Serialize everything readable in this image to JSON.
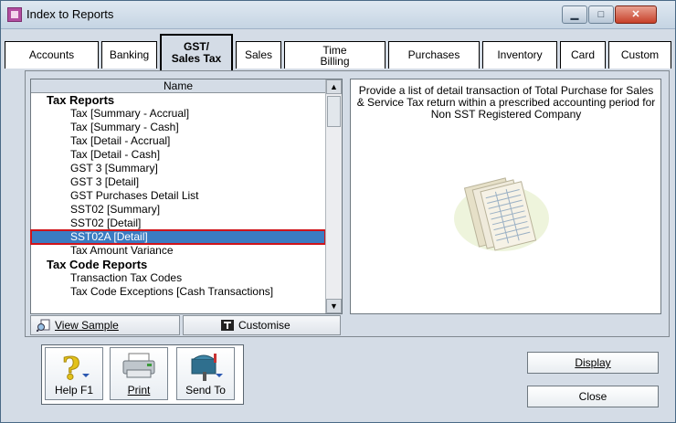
{
  "window": {
    "title": "Index to Reports"
  },
  "tabs": [
    {
      "label_a": "Accounts",
      "label_b": ""
    },
    {
      "label_a": "Banking",
      "label_b": ""
    },
    {
      "label_a": "GST/",
      "label_b": "Sales Tax"
    },
    {
      "label_a": "Sales",
      "label_b": ""
    },
    {
      "label_a": "Time",
      "label_b": "Billing"
    },
    {
      "label_a": "Purchases",
      "label_b": ""
    },
    {
      "label_a": "Inventory",
      "label_b": ""
    },
    {
      "label_a": "Card",
      "label_b": ""
    },
    {
      "label_a": "Custom",
      "label_b": ""
    }
  ],
  "list": {
    "header": "Name",
    "rows": [
      {
        "text": "Tax Reports",
        "type": "category"
      },
      {
        "text": "Tax [Summary - Accrual]",
        "type": "item"
      },
      {
        "text": "Tax [Summary - Cash]",
        "type": "item"
      },
      {
        "text": "Tax [Detail - Accrual]",
        "type": "item"
      },
      {
        "text": "Tax [Detail - Cash]",
        "type": "item"
      },
      {
        "text": "GST 3 [Summary]",
        "type": "item"
      },
      {
        "text": "GST 3 [Detail]",
        "type": "item"
      },
      {
        "text": "GST Purchases Detail List",
        "type": "item"
      },
      {
        "text": "SST02 [Summary]",
        "type": "item"
      },
      {
        "text": "SST02 [Detail]",
        "type": "item"
      },
      {
        "text": "SST02A [Detail]",
        "type": "item",
        "selected": true
      },
      {
        "text": "Tax Amount Variance",
        "type": "item"
      },
      {
        "text": "Tax Code Reports",
        "type": "category"
      },
      {
        "text": "Transaction Tax Codes",
        "type": "item"
      },
      {
        "text": "Tax Code Exceptions [Cash Transactions]",
        "type": "item"
      }
    ]
  },
  "description": "Provide a list of detail transaction of Total Purchase for Sales & Service Tax return within a prescribed accounting period for Non SST Registered Company",
  "panel_buttons": {
    "view_sample": "View Sample",
    "customise": "Customise"
  },
  "bottom_buttons": {
    "help": "Help F1",
    "print": "Print",
    "send_to": "Send To"
  },
  "actions": {
    "display": "Display",
    "close": "Close"
  },
  "icons": [
    "app-icon",
    "minimize-icon",
    "maximize-icon",
    "close-icon",
    "scroll-up-icon",
    "scroll-down-icon",
    "report-sheets-icon",
    "view-sample-icon",
    "customise-icon",
    "help-icon",
    "printer-icon",
    "send-to-icon"
  ]
}
